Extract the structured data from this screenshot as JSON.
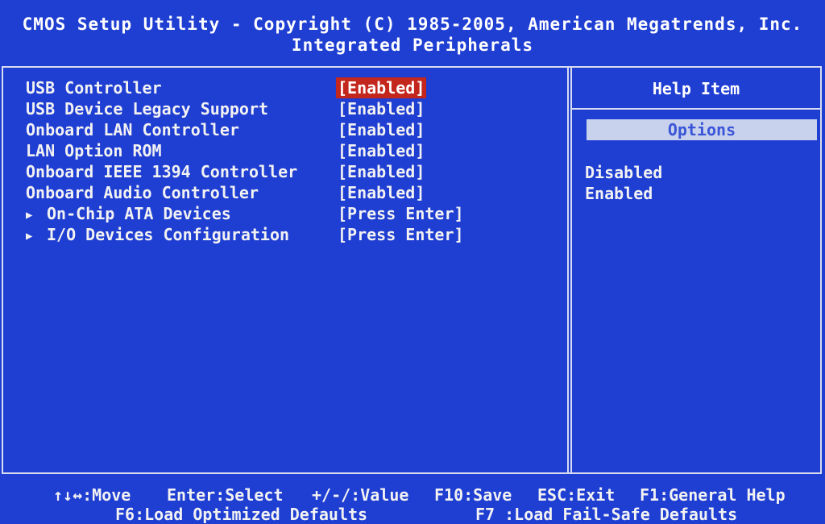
{
  "header": {
    "title": "CMOS Setup Utility - Copyright (C) 1985-2005, American Megatrends, Inc.",
    "subtitle": "Integrated Peripherals"
  },
  "settings": [
    {
      "label": "USB Controller",
      "value": "[Enabled]",
      "submenu": false,
      "selected": true
    },
    {
      "label": "USB Device Legacy Support",
      "value": "[Enabled]",
      "submenu": false,
      "selected": false
    },
    {
      "label": "Onboard LAN Controller",
      "value": "[Enabled]",
      "submenu": false,
      "selected": false
    },
    {
      "label": "LAN Option ROM",
      "value": "[Enabled]",
      "submenu": false,
      "selected": false
    },
    {
      "label": "Onboard IEEE 1394 Controller",
      "value": "[Enabled]",
      "submenu": false,
      "selected": false
    },
    {
      "label": "Onboard Audio Controller",
      "value": "[Enabled]",
      "submenu": false,
      "selected": false
    },
    {
      "label": "On-Chip ATA Devices",
      "value": "[Press Enter]",
      "submenu": true,
      "selected": false
    },
    {
      "label": "I/O Devices Configuration",
      "value": "[Press Enter]",
      "submenu": true,
      "selected": false
    }
  ],
  "help": {
    "title": "Help Item",
    "options_label": "Options",
    "options": [
      "Disabled",
      "Enabled"
    ]
  },
  "footer": {
    "line1": [
      {
        "text": "↑↓↔:Move"
      },
      {
        "text": "Enter:Select"
      },
      {
        "text": "+/-/:Value"
      },
      {
        "text": "F10:Save"
      },
      {
        "text": "ESC:Exit"
      },
      {
        "text": "F1:General Help"
      }
    ],
    "line2": [
      {
        "text": "F6:Load Optimized Defaults"
      },
      {
        "text": "F7 :Load Fail-Safe Defaults"
      }
    ]
  },
  "colors": {
    "background": "#1f3ed2",
    "selected_value_bg": "#c3261d",
    "options_bar_bg": "#c8d2ec",
    "text": "#f2f2f2"
  },
  "icons": {
    "submenu": "triangle-right-icon"
  }
}
